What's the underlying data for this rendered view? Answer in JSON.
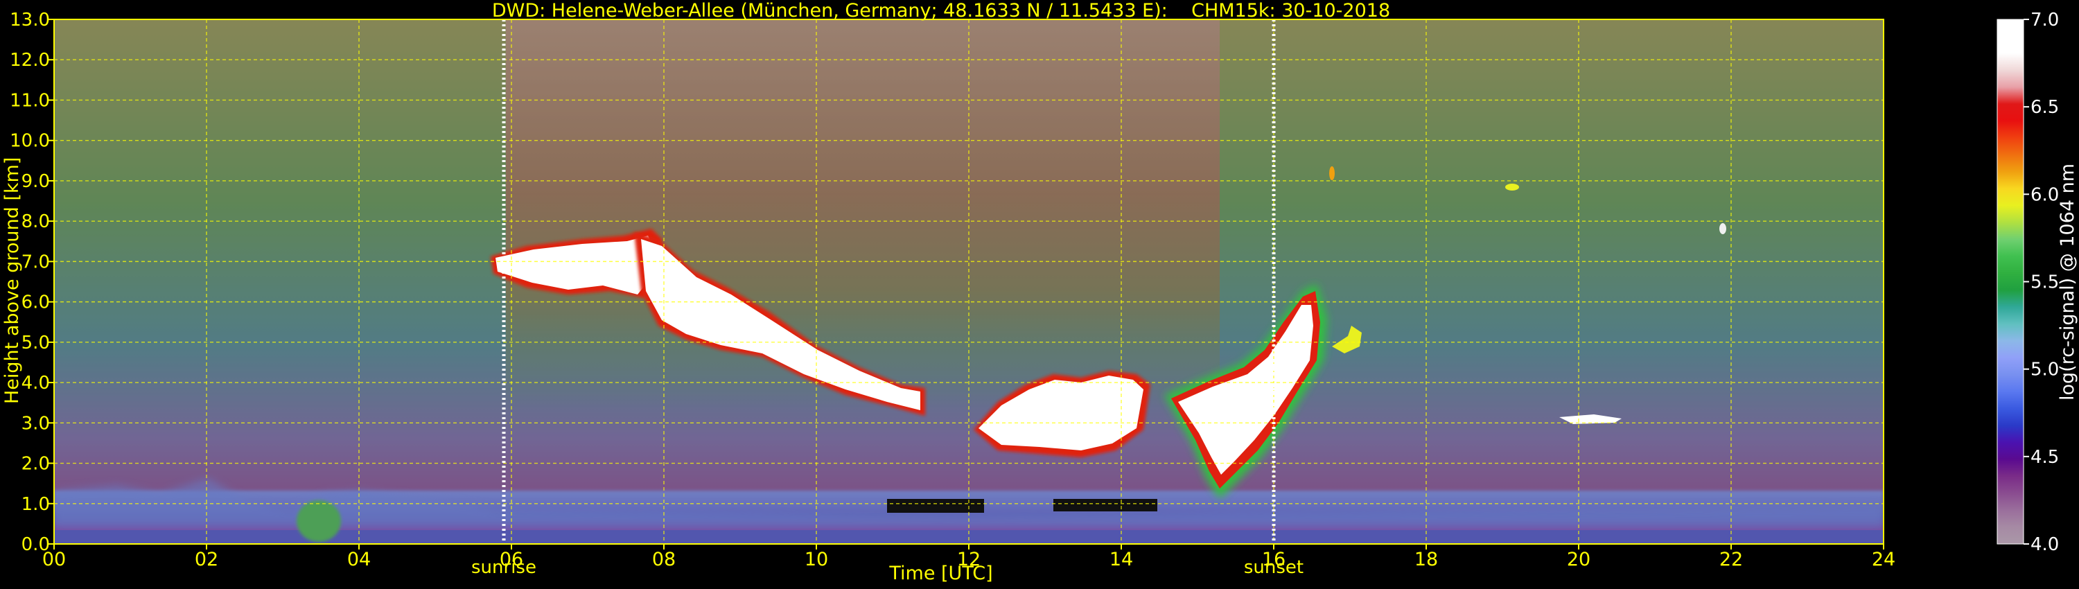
{
  "title": "DWD: Helene-Weber-Allee (München, Germany; 48.1633 N / 11.5433 E):    CHM15k: 30-10-2018",
  "xlabel": "Time [UTC]",
  "ylabel": "Height above ground [km]",
  "colorbar": {
    "label": "log(rc-signal) @ 1064 nm",
    "ticks": [
      "4.0",
      "4.5",
      "5.0",
      "5.5",
      "6.0",
      "6.5",
      "7.0"
    ],
    "range": [
      4.0,
      7.0
    ],
    "colors": [
      "#aa98a8",
      "#a68aa4",
      "#9a6e9c",
      "#8a4c90",
      "#7a2c88",
      "#5a0a90",
      "#4a12b0",
      "#2a3ac8",
      "#3a5ae0",
      "#5a78f0",
      "#7890f0",
      "#90a0f8",
      "#8cb8e8",
      "#60c0c0",
      "#30a898",
      "#20a040",
      "#30b040",
      "#40c050",
      "#70d070",
      "#b0e040",
      "#e8f020",
      "#f8d820",
      "#f0a010",
      "#f07010",
      "#f04010",
      "#e81010",
      "#e01818",
      "#e8a0a8",
      "#f0d8d8",
      "#ffffff",
      "#ffffff",
      "#ffffff"
    ]
  },
  "events": [
    {
      "label": "sunrise",
      "hour": 5.9
    },
    {
      "label": "sunset",
      "hour": 16.0
    }
  ],
  "chart_data": {
    "type": "heatmap",
    "title": "DWD: Helene-Weber-Allee (München, Germany; 48.1633 N / 11.5433 E):    CHM15k: 30-10-2018",
    "xlabel": "Time [UTC]",
    "ylabel": "Height above ground [km]",
    "xlim": [
      0,
      24
    ],
    "ylim": [
      0,
      13
    ],
    "x_ticks": [
      "00",
      "02",
      "04",
      "06",
      "08",
      "10",
      "12",
      "14",
      "16",
      "18",
      "20",
      "22",
      "24"
    ],
    "y_ticks": [
      "0.0",
      "1.0",
      "2.0",
      "3.0",
      "4.0",
      "5.0",
      "6.0",
      "7.0",
      "8.0",
      "9.0",
      "10.0",
      "11.0",
      "12.0",
      "13.0"
    ],
    "grid": true,
    "colorbar_label": "log(rc-signal) @ 1064 nm",
    "colorbar_range": [
      4.0,
      7.0
    ],
    "annotations": [
      {
        "label": "sunrise",
        "x": 5.9
      },
      {
        "label": "sunset",
        "x": 16.0
      }
    ],
    "cloud_features": [
      {
        "t": [
          5.7,
          7.6
        ],
        "h_km": [
          6.0,
          7.6
        ]
      },
      {
        "t": [
          7.8,
          10.4
        ],
        "h_km": [
          3.2,
          7.0
        ]
      },
      {
        "t": [
          12.1,
          14.0
        ],
        "h_km": [
          2.3,
          4.2
        ]
      },
      {
        "t": [
          14.3,
          16.5
        ],
        "h_km": [
          1.0,
          6.5
        ]
      },
      {
        "t": [
          18.4,
          19.0
        ],
        "h_km": [
          3.0,
          3.2
        ]
      }
    ],
    "boundary_layer": {
      "t": [
        0,
        24
      ],
      "h_km": [
        0,
        1.3
      ]
    }
  }
}
